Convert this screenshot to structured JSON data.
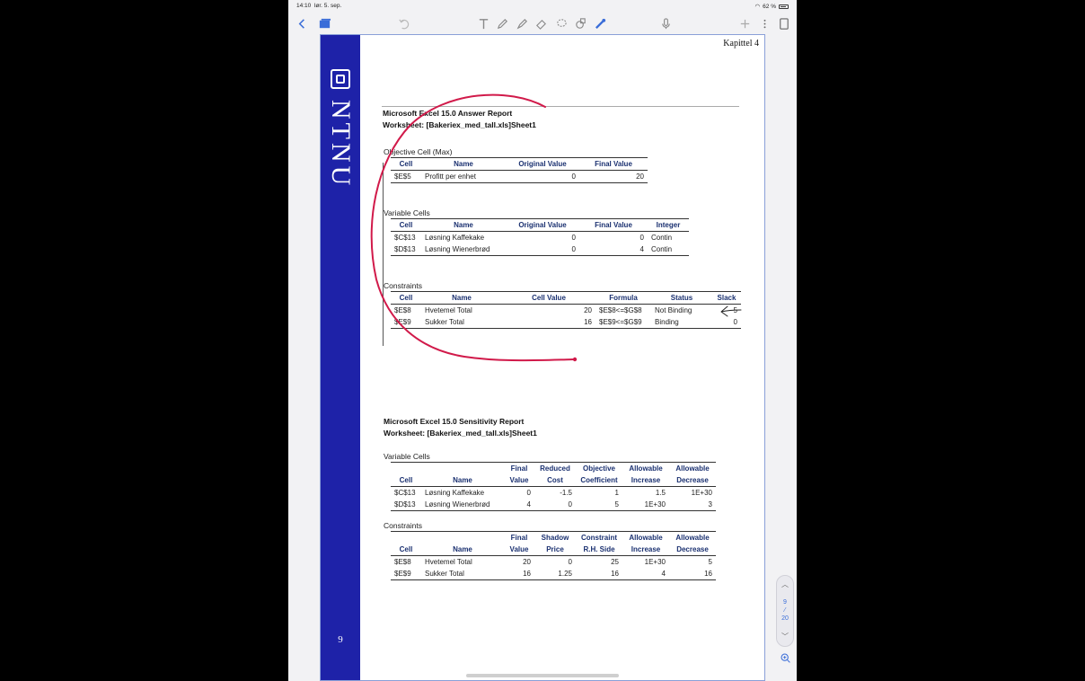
{
  "status": {
    "time": "14:10",
    "date": "lør. 5. sep.",
    "battery": "62 %"
  },
  "toolbar": {
    "icons": [
      "back-chevron-icon",
      "thumbnails-icon",
      "undo-icon",
      "text-tool-icon",
      "pen-icon",
      "highlighter-icon",
      "eraser-icon",
      "lasso-icon",
      "shapes-icon",
      "laser-pointer-icon",
      "microphone-icon",
      "add-icon",
      "more-icon",
      "page-layout-icon"
    ]
  },
  "document": {
    "chapter": "Kapittel 4",
    "logo_text": "NTNU",
    "page_number": "9",
    "answer_report": {
      "title": "Microsoft Excel 15.0 Answer Report",
      "worksheet": "Worksheet: [Bakeriex_med_tall.xls]Sheet1",
      "objective": {
        "label": "Objective Cell (Max)",
        "headers": [
          "Cell",
          "Name",
          "Original Value",
          "Final Value"
        ],
        "rows": [
          [
            "$E$5",
            "Profitt per enhet",
            "0",
            "20"
          ]
        ]
      },
      "variables": {
        "label": "Variable Cells",
        "headers": [
          "Cell",
          "Name",
          "Original Value",
          "Final Value",
          "Integer"
        ],
        "rows": [
          [
            "$C$13",
            "Løsning Kaffekake",
            "0",
            "0",
            "Contin"
          ],
          [
            "$D$13",
            "Løsning Wienerbrød",
            "0",
            "4",
            "Contin"
          ]
        ]
      },
      "constraints": {
        "label": "Constraints",
        "headers": [
          "Cell",
          "Name",
          "Cell Value",
          "Formula",
          "Status",
          "Slack"
        ],
        "rows": [
          [
            "$E$8",
            "Hvetemel  Total",
            "20",
            "$E$8<=$G$8",
            "Not Binding",
            "5"
          ],
          [
            "$E$9",
            "Sukker  Total",
            "16",
            "$E$9<=$G$9",
            "Binding",
            "0"
          ]
        ]
      }
    },
    "sensitivity_report": {
      "title": "Microsoft Excel 15.0 Sensitivity Report",
      "worksheet": "Worksheet: [Bakeriex_med_tall.xls]Sheet1",
      "variables": {
        "label": "Variable Cells",
        "headers_top": [
          "",
          "",
          "Final",
          "Reduced",
          "Objective",
          "Allowable",
          "Allowable"
        ],
        "headers": [
          "Cell",
          "Name",
          "Value",
          "Cost",
          "Coefficient",
          "Increase",
          "Decrease"
        ],
        "rows": [
          [
            "$C$13",
            "Løsning Kaffekake",
            "0",
            "-1.5",
            "1",
            "1.5",
            "1E+30"
          ],
          [
            "$D$13",
            "Løsning Wienerbrød",
            "4",
            "0",
            "5",
            "1E+30",
            "3"
          ]
        ]
      },
      "constraints": {
        "label": "Constraints",
        "headers_top": [
          "",
          "",
          "Final",
          "Shadow",
          "Constraint",
          "Allowable",
          "Allowable"
        ],
        "headers": [
          "Cell",
          "Name",
          "Value",
          "Price",
          "R.H. Side",
          "Increase",
          "Decrease"
        ],
        "rows": [
          [
            "$E$8",
            "Hvetemel  Total",
            "20",
            "0",
            "25",
            "1E+30",
            "5"
          ],
          [
            "$E$9",
            "Sukker  Total",
            "16",
            "1.25",
            "16",
            "4",
            "16"
          ]
        ]
      }
    }
  },
  "pager": {
    "current": "9",
    "total": "20"
  },
  "colors": {
    "brand_blue": "#1e22a8",
    "ink_red": "#d11a4a",
    "accent": "#3a6dd8"
  }
}
